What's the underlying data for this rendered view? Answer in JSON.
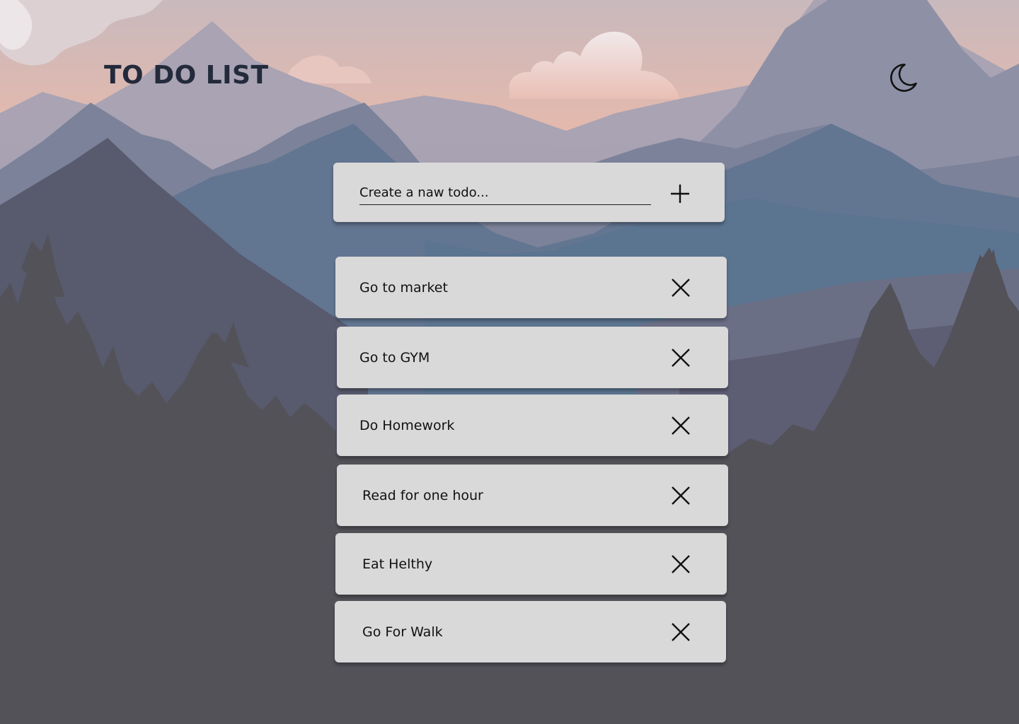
{
  "app": {
    "title": "TO DO LIST"
  },
  "header": {
    "theme_toggle_icon": "moon-icon"
  },
  "create": {
    "placeholder": "Create a naw todo...",
    "value": "",
    "add_icon": "plus-icon"
  },
  "todos": [
    {
      "label": "Go to market",
      "delete_icon": "close-icon"
    },
    {
      "label": "Go to GYM",
      "delete_icon": "close-icon"
    },
    {
      "label": "Do Homework",
      "delete_icon": "close-icon"
    },
    {
      "label": "Read for one hour",
      "delete_icon": "close-icon"
    },
    {
      "label": "Eat Helthy",
      "delete_icon": "close-icon"
    },
    {
      "label": "Go For Walk",
      "delete_icon": "close-icon"
    }
  ],
  "colors": {
    "title": "#232a3c",
    "card": "#d9d9d9",
    "ground": "#535259",
    "sky_top": "#c9b9bd",
    "sky_glow": "#f0bca7"
  }
}
